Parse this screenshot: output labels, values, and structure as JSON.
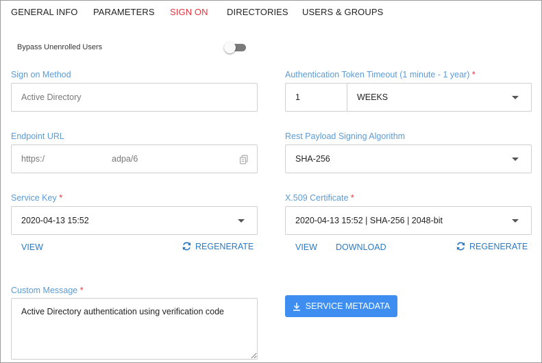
{
  "tabs": [
    {
      "label": "GENERAL INFO"
    },
    {
      "label": "PARAMETERS"
    },
    {
      "label": "SIGN ON"
    },
    {
      "label": "DIRECTORIES"
    },
    {
      "label": "USERS & GROUPS"
    }
  ],
  "active_tab": "SIGN ON",
  "bypass": {
    "label": "Bypass Unenrolled Users",
    "enabled": false
  },
  "sign_on_method": {
    "label": "Sign on Method",
    "value": "Active Directory"
  },
  "token_timeout": {
    "label": "Authentication Token Timeout (1 minute - 1 year)",
    "required_mark": "*",
    "amount": "1",
    "unit": "WEEKS"
  },
  "endpoint": {
    "label": "Endpoint URL",
    "value_prefix": "https:/",
    "value_suffix": "adpa/6"
  },
  "rest_payload": {
    "label": "Rest Payload Signing Algorithm",
    "value": "SHA-256"
  },
  "service_key": {
    "label": "Service Key",
    "required_mark": "*",
    "value": "2020-04-13 15:52",
    "view_label": "VIEW",
    "regenerate_label": "REGENERATE"
  },
  "certificate": {
    "label": "X.509 Certificate",
    "required_mark": "*",
    "value": "2020-04-13 15:52 | SHA-256 | 2048-bit",
    "view_label": "VIEW",
    "download_label": "DOWNLOAD",
    "regenerate_label": "REGENERATE"
  },
  "custom_message": {
    "label": "Custom Message",
    "required_mark": "*",
    "value": "Active Directory authentication using verification code"
  },
  "service_metadata": {
    "label": "SERVICE METADATA"
  },
  "colors": {
    "accent_blue": "#3d8ef0",
    "label_blue": "#5b9bd5",
    "link_blue": "#2a7ac4",
    "active_tab_red": "#e8333c"
  },
  "icons": {
    "copy": "copy-icon",
    "refresh": "refresh-icon",
    "download": "download-icon",
    "dropdown": "chevron-down-icon"
  }
}
